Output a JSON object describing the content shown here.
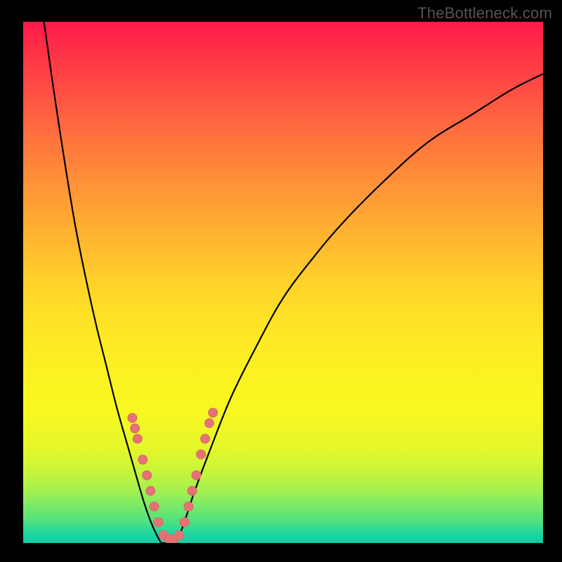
{
  "watermark": "TheBottleneck.com",
  "colors": {
    "curve": "#000000",
    "marker_fill": "#e57373",
    "marker_stroke": "#d86a6a",
    "frame": "#000000"
  },
  "chart_data": {
    "type": "line",
    "title": "",
    "xlabel": "",
    "ylabel": "",
    "xlim": [
      0,
      100
    ],
    "ylim": [
      0,
      100
    ],
    "grid": false,
    "legend": false,
    "series": [
      {
        "name": "left-curve",
        "x": [
          4,
          6,
          8,
          10,
          12,
          14,
          16,
          18,
          20,
          22,
          23.5,
          25,
          26.5
        ],
        "values": [
          100,
          86,
          73,
          61,
          51,
          42,
          34,
          26,
          19,
          12,
          7,
          3,
          0
        ]
      },
      {
        "name": "right-curve",
        "x": [
          29.5,
          31,
          33,
          36,
          40,
          45,
          50,
          56,
          62,
          70,
          78,
          86,
          94,
          100
        ],
        "values": [
          0,
          4,
          10,
          18,
          28,
          38,
          47,
          55,
          62,
          70,
          77,
          82,
          87,
          90
        ]
      },
      {
        "name": "floor",
        "x": [
          26.5,
          29.5
        ],
        "values": [
          0,
          0
        ]
      }
    ],
    "markers": {
      "name": "highlighted-points",
      "points": [
        {
          "x": 21.0,
          "y": 24.0
        },
        {
          "x": 21.5,
          "y": 22.0
        },
        {
          "x": 22.0,
          "y": 20.0
        },
        {
          "x": 23.0,
          "y": 16.0
        },
        {
          "x": 23.8,
          "y": 13.0
        },
        {
          "x": 24.5,
          "y": 10.0
        },
        {
          "x": 25.2,
          "y": 7.0
        },
        {
          "x": 26.0,
          "y": 4.0
        },
        {
          "x": 27.0,
          "y": 1.5
        },
        {
          "x": 28.0,
          "y": 0.8
        },
        {
          "x": 29.0,
          "y": 0.8
        },
        {
          "x": 30.0,
          "y": 1.5
        },
        {
          "x": 31.0,
          "y": 4.0
        },
        {
          "x": 31.8,
          "y": 7.0
        },
        {
          "x": 32.5,
          "y": 10.0
        },
        {
          "x": 33.3,
          "y": 13.0
        },
        {
          "x": 34.2,
          "y": 17.0
        },
        {
          "x": 35.0,
          "y": 20.0
        },
        {
          "x": 35.8,
          "y": 23.0
        },
        {
          "x": 36.5,
          "y": 25.0
        }
      ]
    }
  }
}
